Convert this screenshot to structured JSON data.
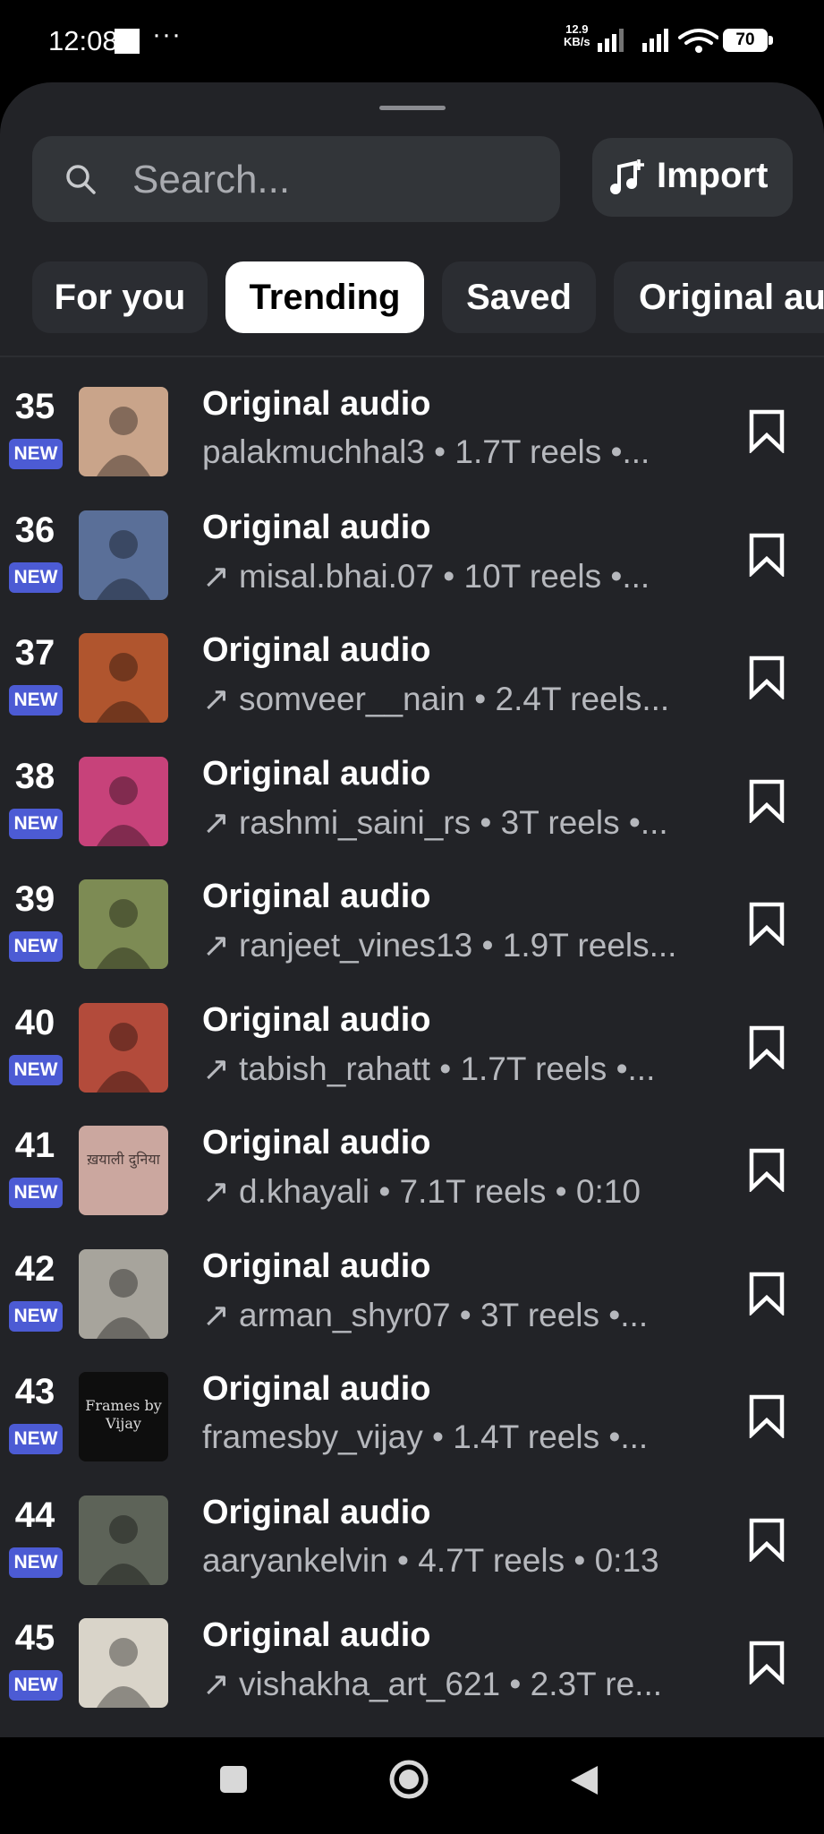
{
  "status": {
    "time": "12:08",
    "dots": "···",
    "net_speed_value": "12.9",
    "net_speed_unit": "KB/s",
    "battery": "70"
  },
  "search": {
    "placeholder": "Search..."
  },
  "import": {
    "label": "Import"
  },
  "tabs": [
    {
      "label": "For you",
      "active": false
    },
    {
      "label": "Trending",
      "active": true
    },
    {
      "label": "Saved",
      "active": false
    },
    {
      "label": "Original audio",
      "active": false
    }
  ],
  "badge_new": "NEW",
  "items": [
    {
      "rank": "35",
      "title": "Original audio",
      "subtitle": "palakmuchhal3 • 1.7T reels •...",
      "trend": false,
      "thumb_color": "#c9a48a"
    },
    {
      "rank": "36",
      "title": "Original audio",
      "subtitle": "misal.bhai.07 • 10T reels •...",
      "trend": true,
      "thumb_color": "#5a6f98"
    },
    {
      "rank": "37",
      "title": "Original audio",
      "subtitle": "somveer__nain • 2.4T reels...",
      "trend": true,
      "thumb_color": "#b0552e"
    },
    {
      "rank": "38",
      "title": "Original audio",
      "subtitle": "rashmi_saini_rs • 3T reels •...",
      "trend": true,
      "thumb_color": "#c7427a"
    },
    {
      "rank": "39",
      "title": "Original audio",
      "subtitle": "ranjeet_vines13 • 1.9T reels...",
      "trend": true,
      "thumb_color": "#7d8b54"
    },
    {
      "rank": "40",
      "title": "Original audio",
      "subtitle": "tabish_rahatt • 1.7T reels •...",
      "trend": true,
      "thumb_color": "#b34b3b"
    },
    {
      "rank": "41",
      "title": "Original audio",
      "subtitle": "d.khayali • 7.1T reels • 0:10",
      "trend": true,
      "thumb_color": "#cba79f",
      "thumb_text": "ख़याली दुनिया"
    },
    {
      "rank": "42",
      "title": "Original audio",
      "subtitle": "arman_shyr07 • 3T reels •...",
      "trend": true,
      "thumb_color": "#a7a49c"
    },
    {
      "rank": "43",
      "title": "Original audio",
      "subtitle": "framesby_vijay • 1.4T reels •...",
      "trend": false,
      "thumb_color": "#0e0e0e",
      "thumb_text": "Frames by Vijay"
    },
    {
      "rank": "44",
      "title": "Original audio",
      "subtitle": "aaryankelvin • 4.7T reels • 0:13",
      "trend": false,
      "thumb_color": "#5d6358"
    },
    {
      "rank": "45",
      "title": "Original audio",
      "subtitle": "vishakha_art_621 • 2.3T re...",
      "trend": true,
      "thumb_color": "#d9d4c9"
    }
  ]
}
